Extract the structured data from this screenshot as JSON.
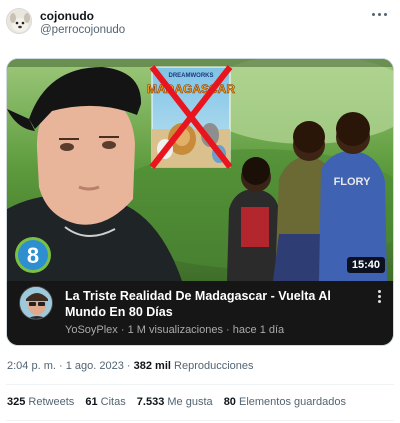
{
  "tweet": {
    "display_name": "cojonudo",
    "handle": "@perrocojonudo",
    "more_icon": "more-horizontal-icon"
  },
  "video_card": {
    "title": "La Triste Realidad De Madagascar - Vuelta Al Mundo En 80 Días",
    "channel": "YoSoyPlex",
    "views": "1 M visualizaciones",
    "age": "hace 1 día",
    "duration": "15:40",
    "thumbnail": {
      "poster_logo": "DREAMWORKS",
      "poster_title": "MADAGASCAR",
      "shirt_text": "FLORY",
      "badge_number": "8"
    }
  },
  "meta": {
    "time": "2:04 p. m.",
    "date": "1 ago. 2023",
    "views_count": "382 mil",
    "views_label": "Reproducciones"
  },
  "stats": {
    "retweets_count": "325",
    "retweets_label": "Retweets",
    "quotes_count": "61",
    "quotes_label": "Citas",
    "likes_count": "7.533",
    "likes_label": "Me gusta",
    "bookmarks_count": "80",
    "bookmarks_label": "Elementos guardados"
  }
}
